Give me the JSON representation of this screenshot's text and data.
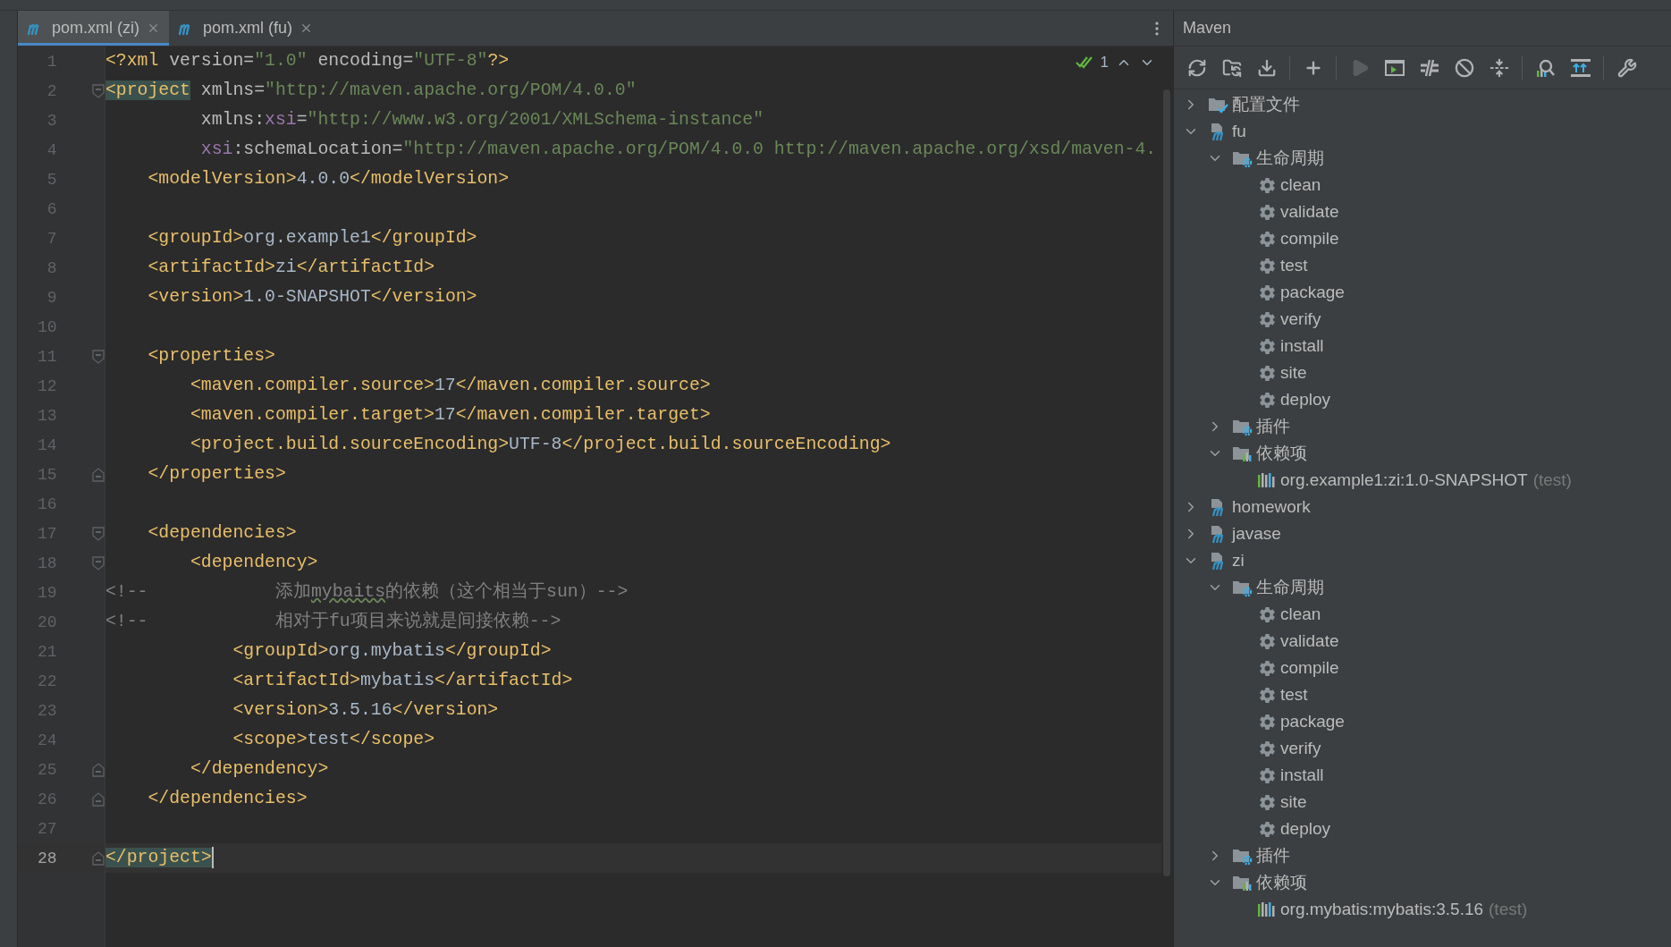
{
  "tabs": [
    {
      "label": "pom.xml (zi)",
      "selected": true
    },
    {
      "label": "pom.xml (fu)",
      "selected": false
    }
  ],
  "inspection": {
    "count": "1"
  },
  "lines": [
    {
      "number": "1",
      "current": false,
      "tokens": [
        {
          "kind": "tag",
          "text": "<?xml"
        },
        {
          "kind": "attr",
          "text": " version="
        },
        {
          "kind": "value",
          "text": "\"1.0\""
        },
        {
          "kind": "attr",
          "text": " encoding="
        },
        {
          "kind": "value",
          "text": "\"UTF-8\""
        },
        {
          "kind": "tag",
          "text": "?>"
        }
      ]
    },
    {
      "number": "2",
      "current": false,
      "fold": {
        "kind": "start"
      },
      "tokens": [
        {
          "kind": "match",
          "text": "<project"
        },
        {
          "kind": "attr",
          "text": " xmlns="
        },
        {
          "kind": "value",
          "text": "\"http://maven.apache.org/POM/4.0.0\""
        }
      ]
    },
    {
      "number": "3",
      "current": false,
      "tokens": [
        {
          "kind": "attr",
          "text": "         xmlns:"
        },
        {
          "kind": "ns",
          "text": "xsi"
        },
        {
          "kind": "attr",
          "text": "="
        },
        {
          "kind": "value",
          "text": "\"http://www.w3.org/2001/XMLSchema-instance\""
        }
      ]
    },
    {
      "number": "4",
      "current": false,
      "tokens": [
        {
          "kind": "ns",
          "text": "         xsi"
        },
        {
          "kind": "attr",
          "text": ":schemaLocation="
        },
        {
          "kind": "value",
          "text": "\"http://maven.apache.org/POM/4.0.0 http://maven.apache.org/xsd/maven-4."
        }
      ]
    },
    {
      "number": "5",
      "current": false,
      "tokens": [
        {
          "kind": "tag",
          "text": "    <modelVersion>"
        },
        {
          "kind": "text",
          "text": "4.0.0"
        },
        {
          "kind": "tag",
          "text": "</modelVersion>"
        }
      ]
    },
    {
      "number": "6"
    },
    {
      "number": "7",
      "current": false,
      "tokens": [
        {
          "kind": "tag",
          "text": "    <groupId>"
        },
        {
          "kind": "text",
          "text": "org.example1"
        },
        {
          "kind": "tag",
          "text": "</groupId>"
        }
      ]
    },
    {
      "number": "8",
      "current": false,
      "tokens": [
        {
          "kind": "tag",
          "text": "    <artifactId>"
        },
        {
          "kind": "text",
          "text": "zi"
        },
        {
          "kind": "tag",
          "text": "</artifactId>"
        }
      ]
    },
    {
      "number": "9",
      "current": false,
      "tokens": [
        {
          "kind": "tag",
          "text": "    <version>"
        },
        {
          "kind": "text",
          "text": "1.0-SNAPSHOT"
        },
        {
          "kind": "tag",
          "text": "</version>"
        }
      ]
    },
    {
      "number": "10"
    },
    {
      "number": "11",
      "current": false,
      "fold": {
        "kind": "start"
      },
      "tokens": [
        {
          "kind": "tag",
          "text": "    <properties>"
        }
      ]
    },
    {
      "number": "12",
      "current": false,
      "tokens": [
        {
          "kind": "tag",
          "text": "        <maven.compiler.source>"
        },
        {
          "kind": "text",
          "text": "17"
        },
        {
          "kind": "tag",
          "text": "</maven.compiler.source>"
        }
      ]
    },
    {
      "number": "13",
      "current": false,
      "tokens": [
        {
          "kind": "tag",
          "text": "        <maven.compiler.target>"
        },
        {
          "kind": "text",
          "text": "17"
        },
        {
          "kind": "tag",
          "text": "</maven.compiler.target>"
        }
      ]
    },
    {
      "number": "14",
      "current": false,
      "tokens": [
        {
          "kind": "tag",
          "text": "        <project.build.sourceEncoding>"
        },
        {
          "kind": "text",
          "text": "UTF-8"
        },
        {
          "kind": "tag",
          "text": "</project.build.sourceEncoding>"
        }
      ]
    },
    {
      "number": "15",
      "current": false,
      "fold": {
        "kind": "end"
      },
      "tokens": [
        {
          "kind": "tag",
          "text": "    </properties>"
        }
      ]
    },
    {
      "number": "16"
    },
    {
      "number": "17",
      "current": false,
      "fold": {
        "kind": "start"
      },
      "tokens": [
        {
          "kind": "tag",
          "text": "    <dependencies>"
        }
      ]
    },
    {
      "number": "18",
      "current": false,
      "fold": {
        "kind": "start"
      },
      "tokens": [
        {
          "kind": "tag",
          "text": "        <dependency>"
        }
      ]
    },
    {
      "number": "19",
      "current": false,
      "tokens": [
        {
          "kind": "comment",
          "text": "<!--            添加"
        },
        {
          "kind": "typo",
          "text": "mybaits"
        },
        {
          "kind": "comment",
          "text": "的依赖（这个相当于sun）-->"
        }
      ]
    },
    {
      "number": "20",
      "current": false,
      "tokens": [
        {
          "kind": "comment",
          "text": "<!--            相对于fu项目来说就是间接依赖-->"
        }
      ]
    },
    {
      "number": "21",
      "current": false,
      "tokens": [
        {
          "kind": "tag",
          "text": "            <groupId>"
        },
        {
          "kind": "text",
          "text": "org.mybatis"
        },
        {
          "kind": "tag",
          "text": "</groupId>"
        }
      ]
    },
    {
      "number": "22",
      "current": false,
      "tokens": [
        {
          "kind": "tag",
          "text": "            <artifactId>"
        },
        {
          "kind": "text",
          "text": "mybatis"
        },
        {
          "kind": "tag",
          "text": "</artifactId>"
        }
      ]
    },
    {
      "number": "23",
      "current": false,
      "tokens": [
        {
          "kind": "tag",
          "text": "            <version>"
        },
        {
          "kind": "text",
          "text": "3.5.16"
        },
        {
          "kind": "tag",
          "text": "</version>"
        }
      ]
    },
    {
      "number": "24",
      "current": false,
      "tokens": [
        {
          "kind": "tag",
          "text": "            <scope>"
        },
        {
          "kind": "text",
          "text": "test"
        },
        {
          "kind": "tag",
          "text": "</scope>"
        }
      ]
    },
    {
      "number": "25",
      "current": false,
      "fold": {
        "kind": "end"
      },
      "tokens": [
        {
          "kind": "tag",
          "text": "        </dependency>"
        }
      ]
    },
    {
      "number": "26",
      "current": false,
      "fold": {
        "kind": "end"
      },
      "tokens": [
        {
          "kind": "tag",
          "text": "    </dependencies>"
        }
      ]
    },
    {
      "number": "27"
    },
    {
      "number": "28",
      "current": true,
      "fold": {
        "kind": "end"
      },
      "tokens": [
        {
          "kind": "match",
          "text": "</project>"
        }
      ]
    }
  ],
  "maven": {
    "title": "Maven",
    "toolbar": [
      {
        "buttons": [
          {
            "kind": "refresh",
            "disabled": false
          },
          {
            "kind": "reimport",
            "disabled": false
          },
          {
            "kind": "download",
            "disabled": false
          }
        ]
      },
      {
        "buttons": [
          {
            "kind": "add",
            "disabled": false
          }
        ]
      },
      {
        "buttons": [
          {
            "kind": "run",
            "disabled": true
          },
          {
            "kind": "console",
            "disabled": false
          },
          {
            "kind": "skip",
            "disabled": false
          },
          {
            "kind": "offline",
            "disabled": false
          },
          {
            "kind": "collapse",
            "disabled": false
          }
        ]
      },
      {
        "buttons": [
          {
            "kind": "analyze",
            "disabled": false
          },
          {
            "kind": "deps",
            "disabled": false
          }
        ]
      },
      {
        "buttons": [
          {
            "kind": "settings",
            "disabled": false
          }
        ]
      }
    ],
    "tree": [
      {
        "label": "配置文件",
        "kind": "profiles",
        "expanded": false
      },
      {
        "label": "fu",
        "kind": "module",
        "expanded": true,
        "children": [
          {
            "label": "生命周期",
            "kind": "lifecycle",
            "expanded": true,
            "children": [
              {
                "label": "clean",
                "kind": "phase"
              },
              {
                "label": "validate",
                "kind": "phase"
              },
              {
                "label": "compile",
                "kind": "phase"
              },
              {
                "label": "test",
                "kind": "phase"
              },
              {
                "label": "package",
                "kind": "phase"
              },
              {
                "label": "verify",
                "kind": "phase"
              },
              {
                "label": "install",
                "kind": "phase"
              },
              {
                "label": "site",
                "kind": "phase"
              },
              {
                "label": "deploy",
                "kind": "phase"
              }
            ]
          },
          {
            "label": "插件",
            "kind": "plugins",
            "expanded": false
          },
          {
            "label": "依赖项",
            "kind": "dependencies",
            "expanded": true,
            "children": [
              {
                "label": "org.example1:zi:1.0-SNAPSHOT",
                "scope": "(test)",
                "kind": "dependency"
              }
            ]
          }
        ]
      },
      {
        "label": "homework",
        "kind": "module",
        "expanded": false
      },
      {
        "label": "javase",
        "kind": "module",
        "expanded": false
      },
      {
        "label": "zi",
        "kind": "module",
        "expanded": true,
        "children": [
          {
            "label": "生命周期",
            "kind": "lifecycle",
            "expanded": true,
            "children": [
              {
                "label": "clean",
                "kind": "phase"
              },
              {
                "label": "validate",
                "kind": "phase"
              },
              {
                "label": "compile",
                "kind": "phase"
              },
              {
                "label": "test",
                "kind": "phase"
              },
              {
                "label": "package",
                "kind": "phase"
              },
              {
                "label": "verify",
                "kind": "phase"
              },
              {
                "label": "install",
                "kind": "phase"
              },
              {
                "label": "site",
                "kind": "phase"
              },
              {
                "label": "deploy",
                "kind": "phase"
              }
            ]
          },
          {
            "label": "插件",
            "kind": "plugins",
            "expanded": false
          },
          {
            "label": "依赖项",
            "kind": "dependencies",
            "expanded": true,
            "children": [
              {
                "label": "org.mybatis:mybatis:3.5.16",
                "scope": "(test)",
                "kind": "dependency"
              }
            ]
          }
        ]
      }
    ]
  }
}
